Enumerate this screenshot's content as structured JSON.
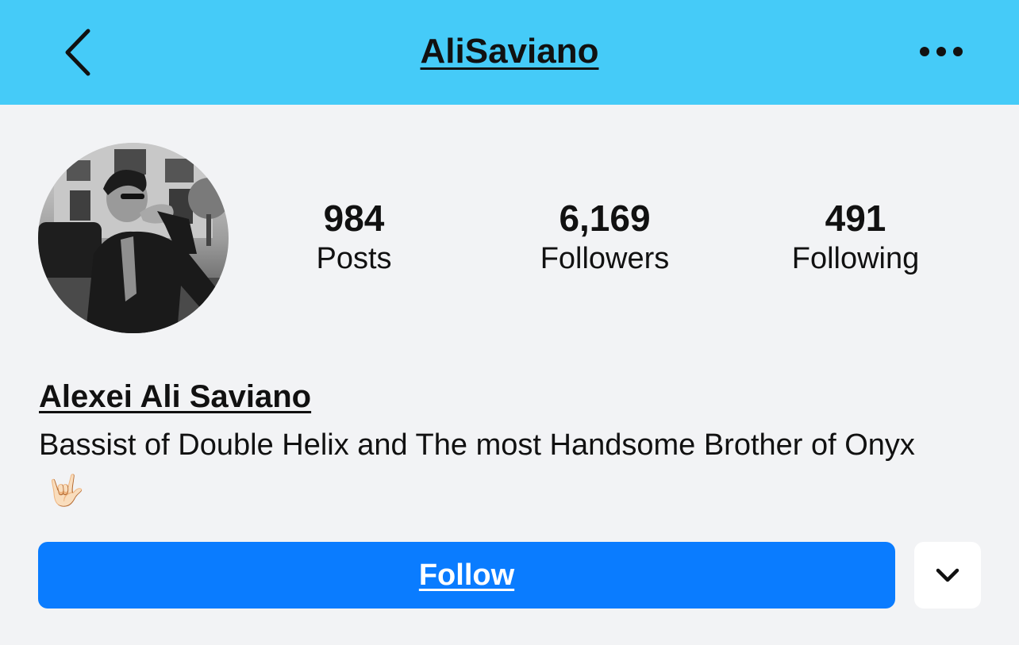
{
  "header": {
    "title": "AliSaviano",
    "back_icon": "chevron-left-icon",
    "more_icon": "more-horizontal-icon",
    "background": "#45cbf8"
  },
  "profile": {
    "avatar_icon": "profile-photo",
    "stats": {
      "posts": {
        "count": "984",
        "label": "Posts"
      },
      "followers": {
        "count": "6,169",
        "label": "Followers"
      },
      "following": {
        "count": "491",
        "label": "Following"
      }
    },
    "display_name": "Alexei Ali Saviano",
    "bio": "Bassist of Double Helix and The most Handsome Brother of Onyx",
    "bio_emoji": "🤟🏻"
  },
  "actions": {
    "follow_label": "Follow",
    "follow_color": "#0a7cff",
    "dropdown_icon": "chevron-down-icon"
  }
}
